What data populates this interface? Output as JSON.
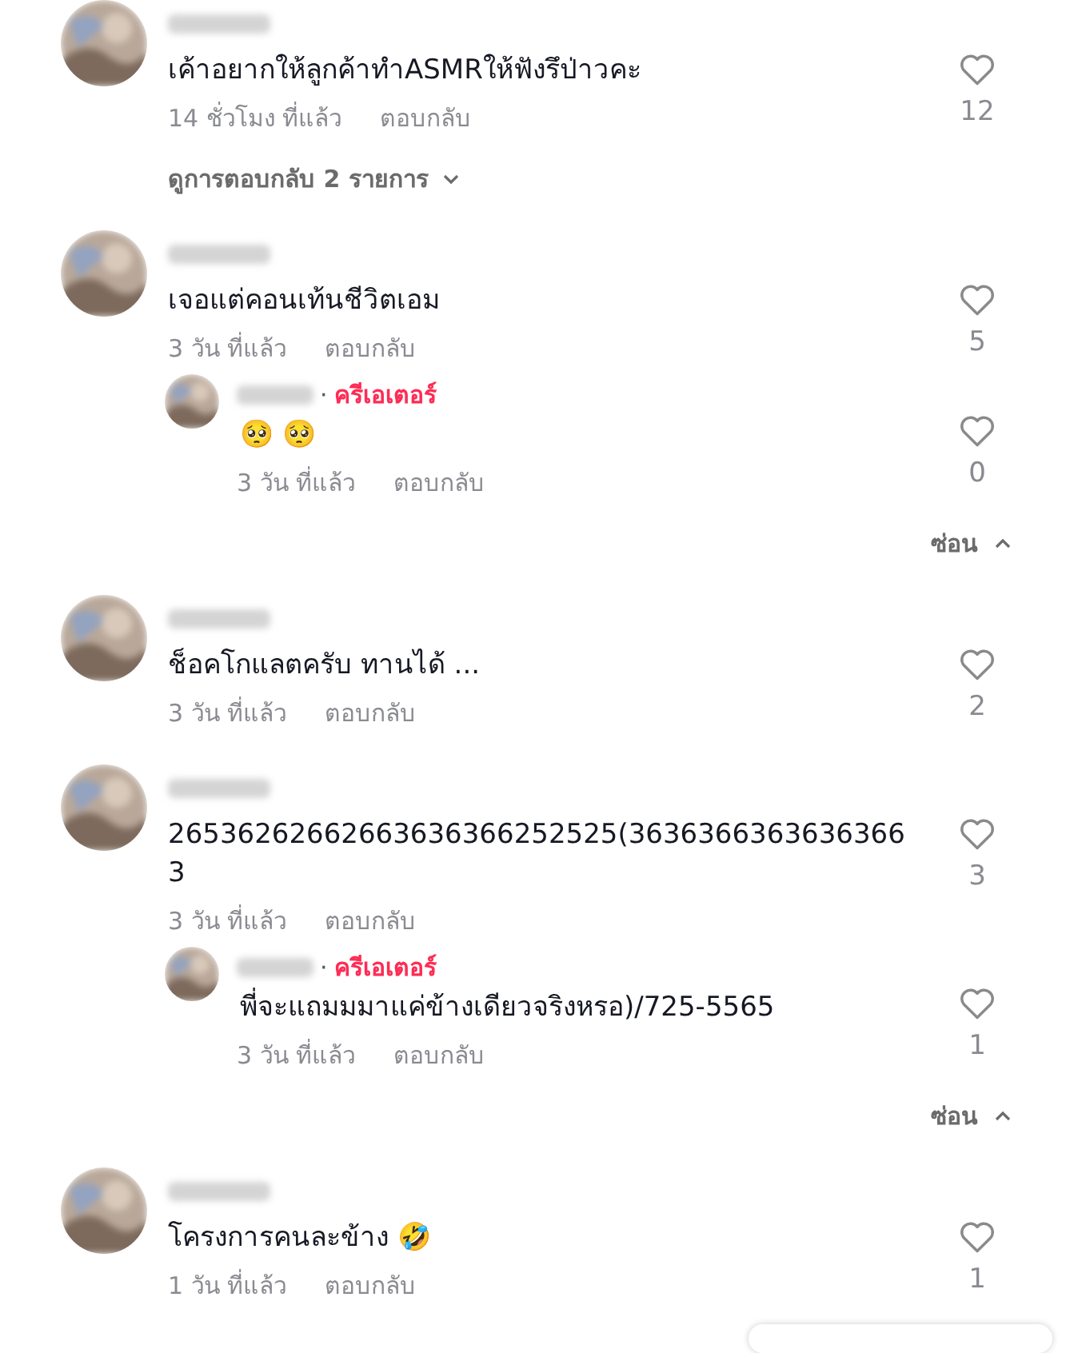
{
  "comments": [
    {
      "text": "เค้าอยากให้ลูกค้าทำASMRให้ฟังรึป่าวคะ",
      "time": "14 ชั่วโมง ที่แล้ว",
      "reply_label": "ตอบกลับ",
      "likes": "12",
      "liked": false,
      "view_replies": "ดูการตอบกลับ 2 รายการ"
    },
    {
      "text": "เจอแต่คอนเท้นชีวิตเอม",
      "time": "3 วัน ที่แล้ว",
      "reply_label": "ตอบกลับ",
      "likes": "5",
      "liked": false,
      "replies": [
        {
          "separator": "·",
          "badge": "ครีเอเตอร์",
          "text": "🥺 🥺",
          "time": "3 วัน ที่แล้ว",
          "reply_label": "ตอบกลับ",
          "likes": "0",
          "liked": false
        }
      ],
      "hide_label": "ซ่อน"
    },
    {
      "text": "ช็อคโกแลตครับ ทานได้ ...",
      "time": "3 วัน ที่แล้ว",
      "reply_label": "ตอบกลับ",
      "likes": "2",
      "liked": false
    },
    {
      "text": "26536262662663636366252525(36363663636363663",
      "time": "3 วัน ที่แล้ว",
      "reply_label": "ตอบกลับ",
      "likes": "3",
      "liked": false,
      "replies": [
        {
          "separator": "·",
          "badge": "ครีเอเตอร์",
          "text": "พี่จะแถมมมาแค่ข้างเดียวจริงหรอ)/725-5565",
          "time": "3 วัน ที่แล้ว",
          "reply_label": "ตอบกลับ",
          "likes": "1",
          "liked": false
        }
      ],
      "hide_label": "ซ่อน"
    },
    {
      "text": "โครงการคนละข้าง 🤣",
      "time": "1 วัน ที่แล้ว",
      "reply_label": "ตอบกลับ",
      "likes": "1",
      "liked": false
    }
  ]
}
